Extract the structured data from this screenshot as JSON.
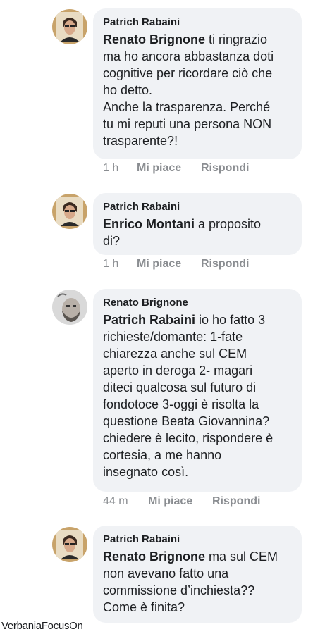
{
  "comments": [
    {
      "author": "Patrich Rabaini",
      "mention": "Renato Brignone",
      "text": " ti ringrazio\nma ho ancora abbastanza doti\ncognitive per ricordare ciò che\nho detto.\nAnche la trasparenza. Perché\ntu mi reputi una persona NON\ntrasparente?!",
      "time": "1 h",
      "like": "Mi piace",
      "reply": "Rispondi"
    },
    {
      "author": "Patrich Rabaini",
      "mention": "Enrico Montani",
      "text": " a proposito\ndi?",
      "time": "1 h",
      "like": "Mi piace",
      "reply": "Rispondi"
    },
    {
      "author": "Renato Brignone",
      "mention": "Patrich Rabaini",
      "text": " io ho fatto 3\nrichieste/domante: 1-fate\nchiarezza anche sul CEM\naperto in deroga 2- magari\nditeci qualcosa sul futuro di\nfondotoce 3-oggi è risolta la\nquestione Beata Giovannina?\nchiedere è lecito, rispondere è\ncortesia, a me hanno\ninsegnato così.",
      "time": "44 m",
      "like": "Mi piace",
      "reply": "Rispondi"
    },
    {
      "author": "Patrich Rabaini",
      "mention": "Renato Brignone",
      "text": " ma sul CEM\nnon avevano fatto una\ncommissione d’inchiesta??\nCome è finita?"
    }
  ],
  "watermark": "VerbaniaFocusOn",
  "colors": {
    "bubble": "#f0f2f5",
    "text": "#1c1e21",
    "muted": "#8a8d91"
  }
}
